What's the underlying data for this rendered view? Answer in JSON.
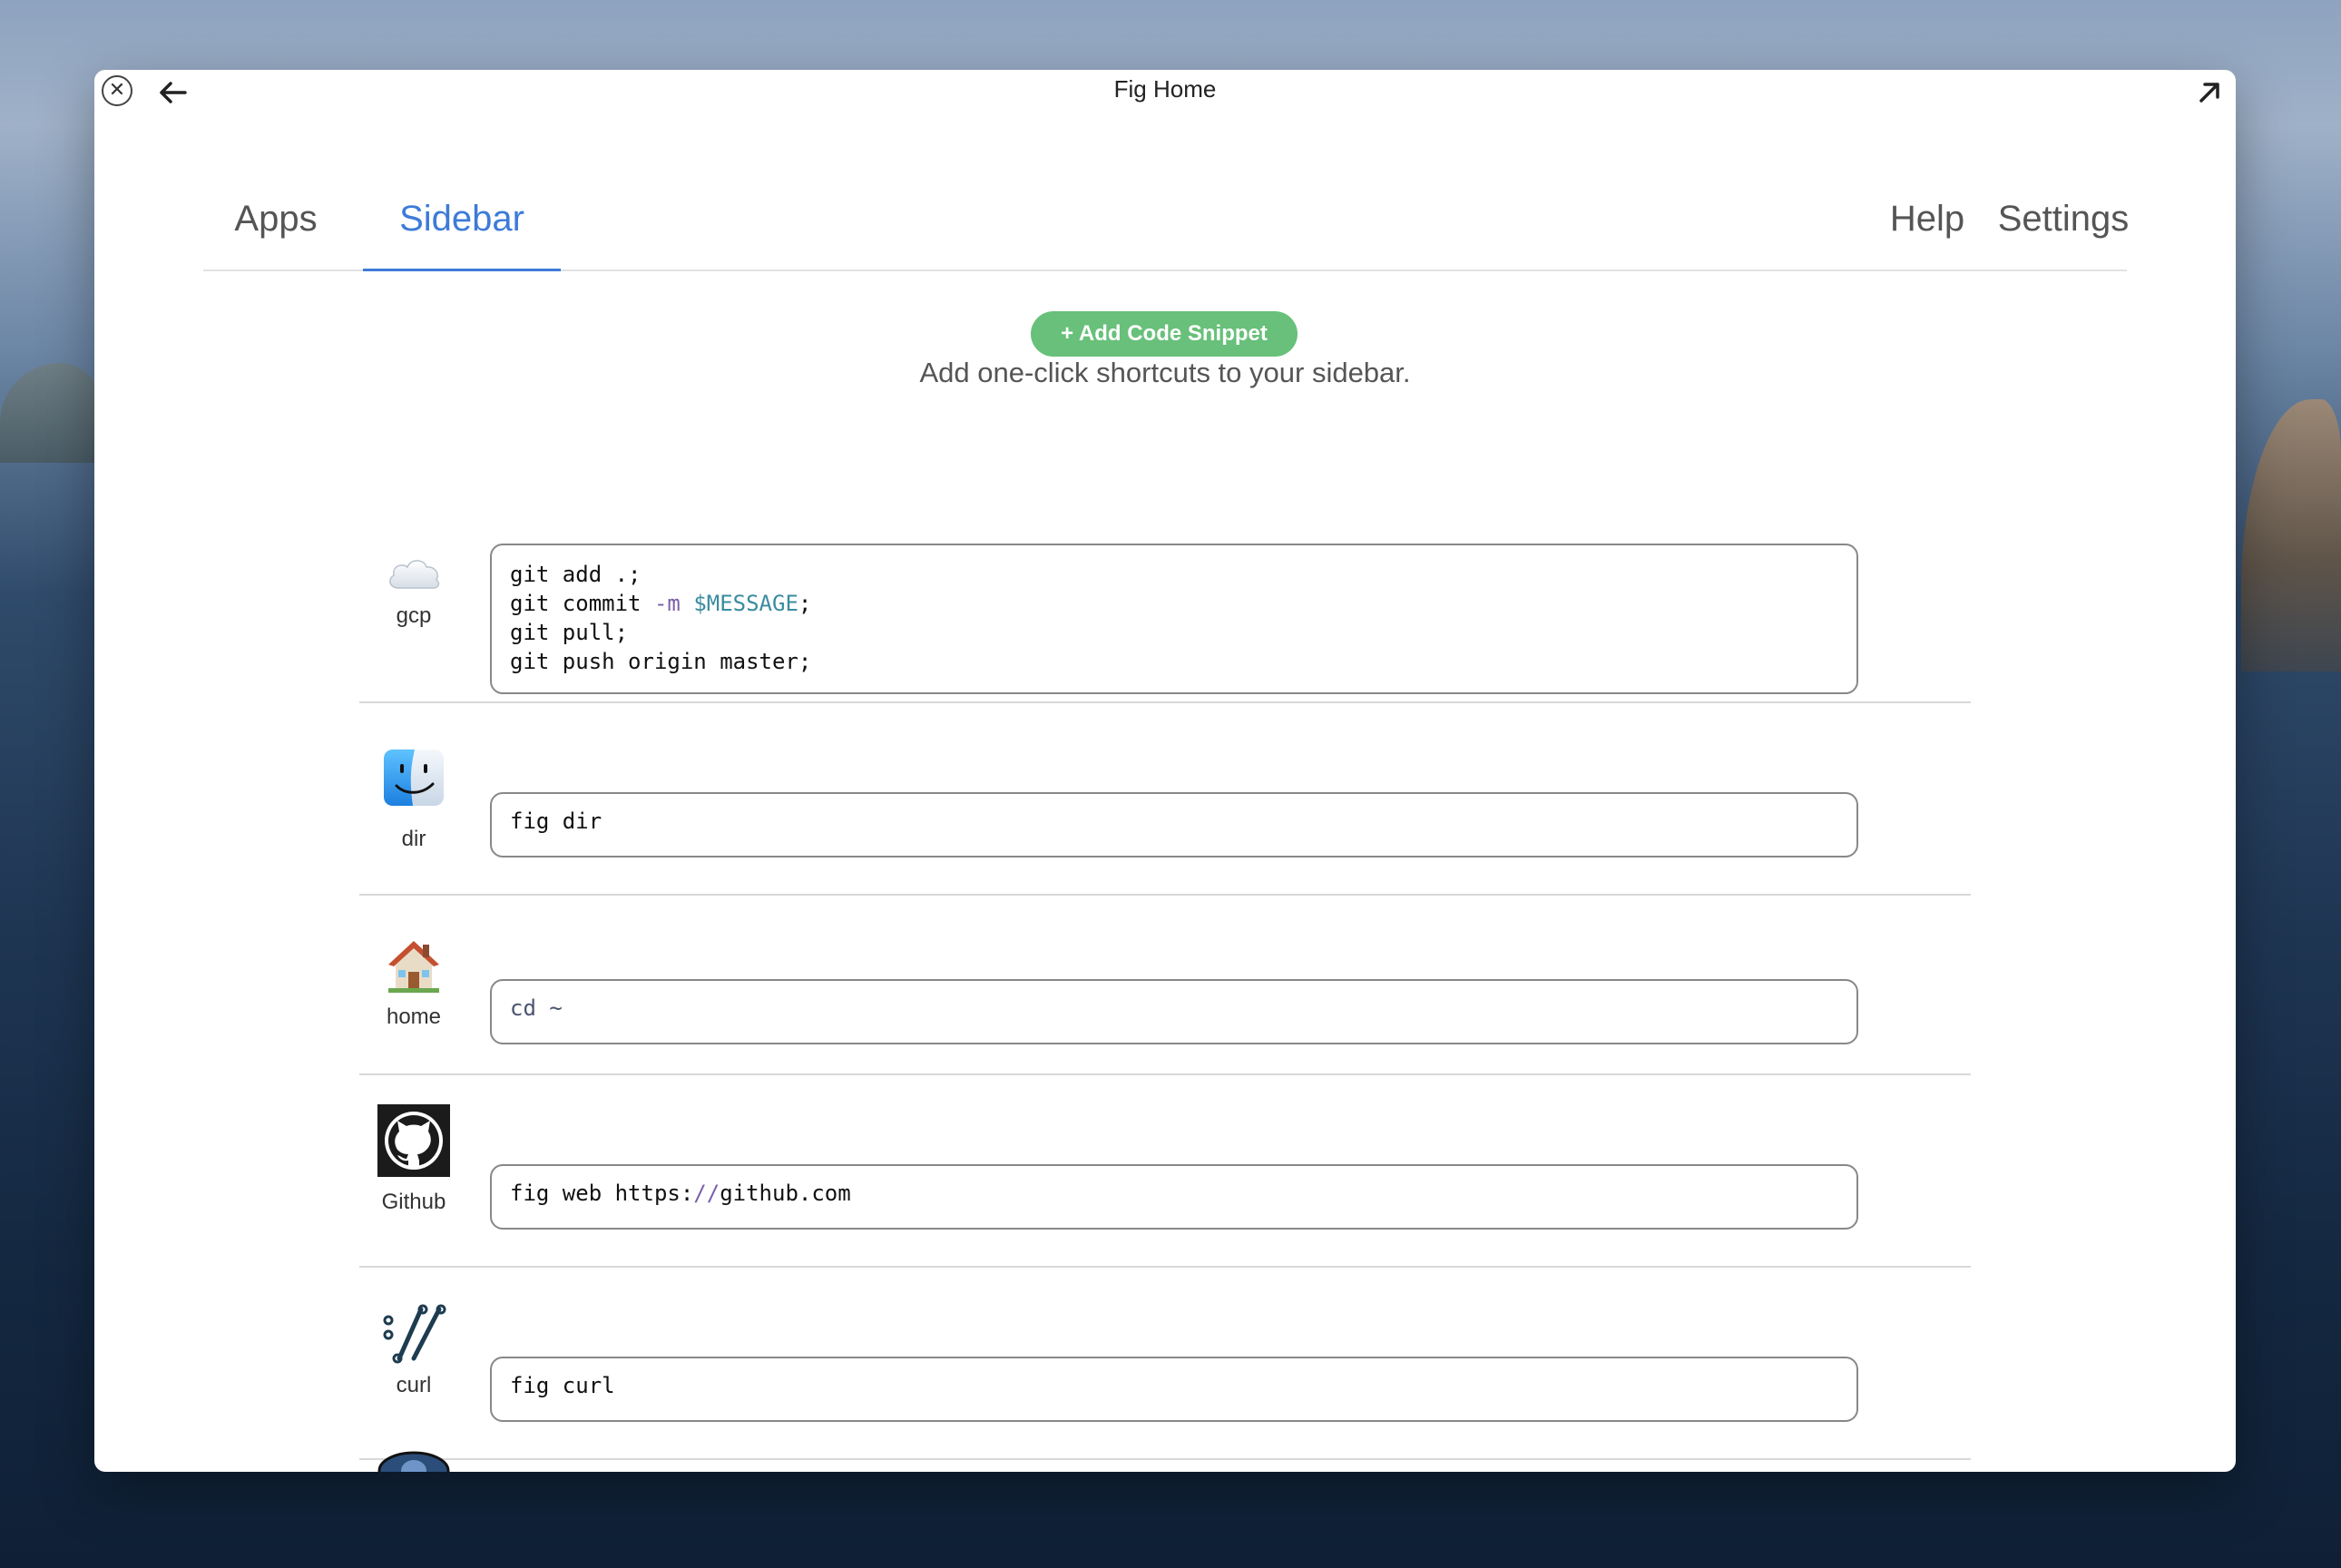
{
  "window": {
    "title": "Fig Home"
  },
  "tabs": [
    {
      "label": "Apps"
    },
    {
      "label": "Sidebar"
    },
    {
      "label": "Help"
    },
    {
      "label": "Settings"
    }
  ],
  "add_snippet_label": "+ Add Code Snippet",
  "subtitle": "Add one-click shortcuts to your sidebar.",
  "snippets": [
    {
      "label": "gcp",
      "icon": "cloud-icon",
      "lines": [
        "git add .;",
        "git commit -m $MESSAGE;",
        "git pull;",
        "git push origin master;"
      ]
    },
    {
      "label": "dir",
      "icon": "finder-icon",
      "command": "fig dir"
    },
    {
      "label": "home",
      "icon": "house-icon",
      "command": "cd ~"
    },
    {
      "label": "Github",
      "icon": "github-icon",
      "command_prefix": "fig web https:",
      "command_slashes": "//",
      "command_suffix": "github.com"
    },
    {
      "label": "curl",
      "icon": "curl-icon",
      "command": "fig curl"
    }
  ],
  "colors": {
    "accent": "#3d7bd8",
    "button": "#68c07a",
    "variable": "#3a8ca0"
  }
}
